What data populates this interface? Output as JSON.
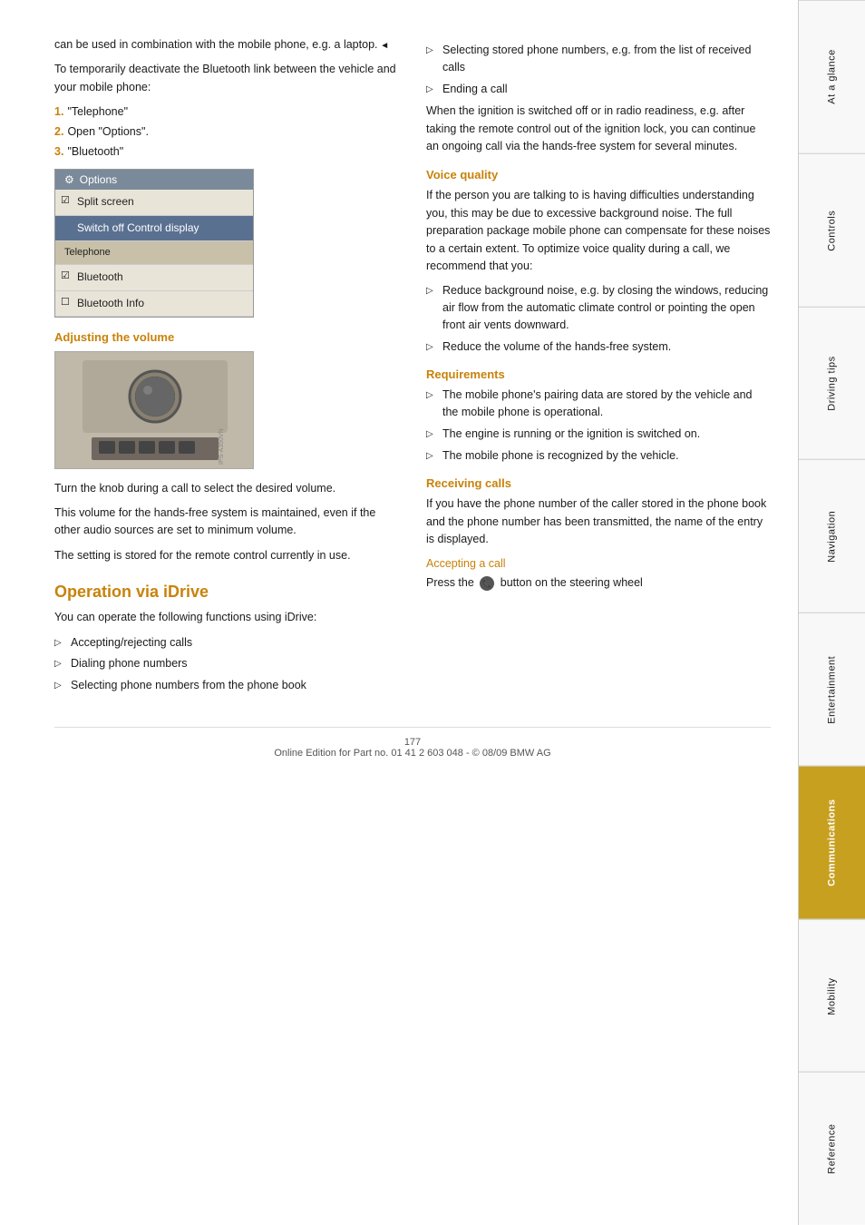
{
  "page": {
    "number": "177",
    "footer": "Online Edition for Part no. 01 41 2 603 048 - © 08/09 BMW AG"
  },
  "sidebar": {
    "sections": [
      {
        "id": "at-a-glance",
        "label": "At a glance",
        "active": false
      },
      {
        "id": "controls",
        "label": "Controls",
        "active": false
      },
      {
        "id": "driving-tips",
        "label": "Driving tips",
        "active": false
      },
      {
        "id": "navigation",
        "label": "Navigation",
        "active": false
      },
      {
        "id": "entertainment",
        "label": "Entertainment",
        "active": false
      },
      {
        "id": "communications",
        "label": "Communications",
        "active": true
      },
      {
        "id": "mobility",
        "label": "Mobility",
        "active": false
      },
      {
        "id": "reference",
        "label": "Reference",
        "active": false
      }
    ]
  },
  "left_column": {
    "intro_text_1": "can be used in combination with the mobile phone, e.g. a laptop.",
    "intro_triangle": "◄",
    "intro_text_2": "To temporarily deactivate the Bluetooth link between the vehicle and your mobile phone:",
    "steps": [
      {
        "num": "1.",
        "text": "\"Telephone\""
      },
      {
        "num": "2.",
        "text": "Open \"Options\"."
      },
      {
        "num": "3.",
        "text": "\"Bluetooth\""
      }
    ],
    "options_menu": {
      "title": "Options",
      "title_icon": "⚙",
      "items": [
        {
          "type": "checked",
          "text": "Split screen"
        },
        {
          "type": "highlighted",
          "text": "Switch off Control display"
        },
        {
          "type": "section",
          "text": "Telephone"
        },
        {
          "type": "checked",
          "text": "Bluetooth"
        },
        {
          "type": "unchecked",
          "text": "Bluetooth Info"
        }
      ]
    },
    "adjusting_volume": {
      "heading": "Adjusting the volume",
      "text_1": "Turn the knob during a call to select the desired volume.",
      "text_2": "This volume for the hands-free system is maintained, even if the other audio sources are set to minimum volume.",
      "text_3": "The setting is stored for the remote control currently in use."
    },
    "operation_heading": "Operation via iDrive",
    "operation_intro": "You can operate the following functions using iDrive:",
    "operation_bullets": [
      "Accepting/rejecting calls",
      "Dialing phone numbers",
      "Selecting phone numbers from the phone book"
    ]
  },
  "right_column": {
    "more_bullets": [
      "Selecting stored phone numbers, e.g. from the list of received calls",
      "Ending a call"
    ],
    "ignition_text": "When the ignition is switched off or in radio readiness, e.g. after taking the remote control out of the ignition lock, you can continue an ongoing call via the hands-free system for several minutes.",
    "voice_quality": {
      "heading": "Voice quality",
      "text": "If the person you are talking to is having difficulties understanding you, this may be due to excessive background noise. The full preparation package mobile phone can compensate for these noises to a certain extent. To optimize voice quality during a call, we recommend that you:",
      "bullets": [
        "Reduce background noise, e.g. by closing the windows, reducing air flow from the automatic climate control or pointing the open front air vents downward.",
        "Reduce the volume of the hands-free system."
      ]
    },
    "requirements": {
      "heading": "Requirements",
      "bullets": [
        "The mobile phone's pairing data are stored by the vehicle and the mobile phone is operational.",
        "The engine is running or the ignition is switched on.",
        "The mobile phone is recognized by the vehicle."
      ]
    },
    "receiving_calls": {
      "heading": "Receiving calls",
      "text": "If you have the phone number of the caller stored in the phone book and the phone number has been transmitted, the name of the entry is displayed.",
      "accepting_heading": "Accepting a call",
      "accepting_text": "Press the",
      "accepting_text2": "button on the steering wheel"
    }
  }
}
